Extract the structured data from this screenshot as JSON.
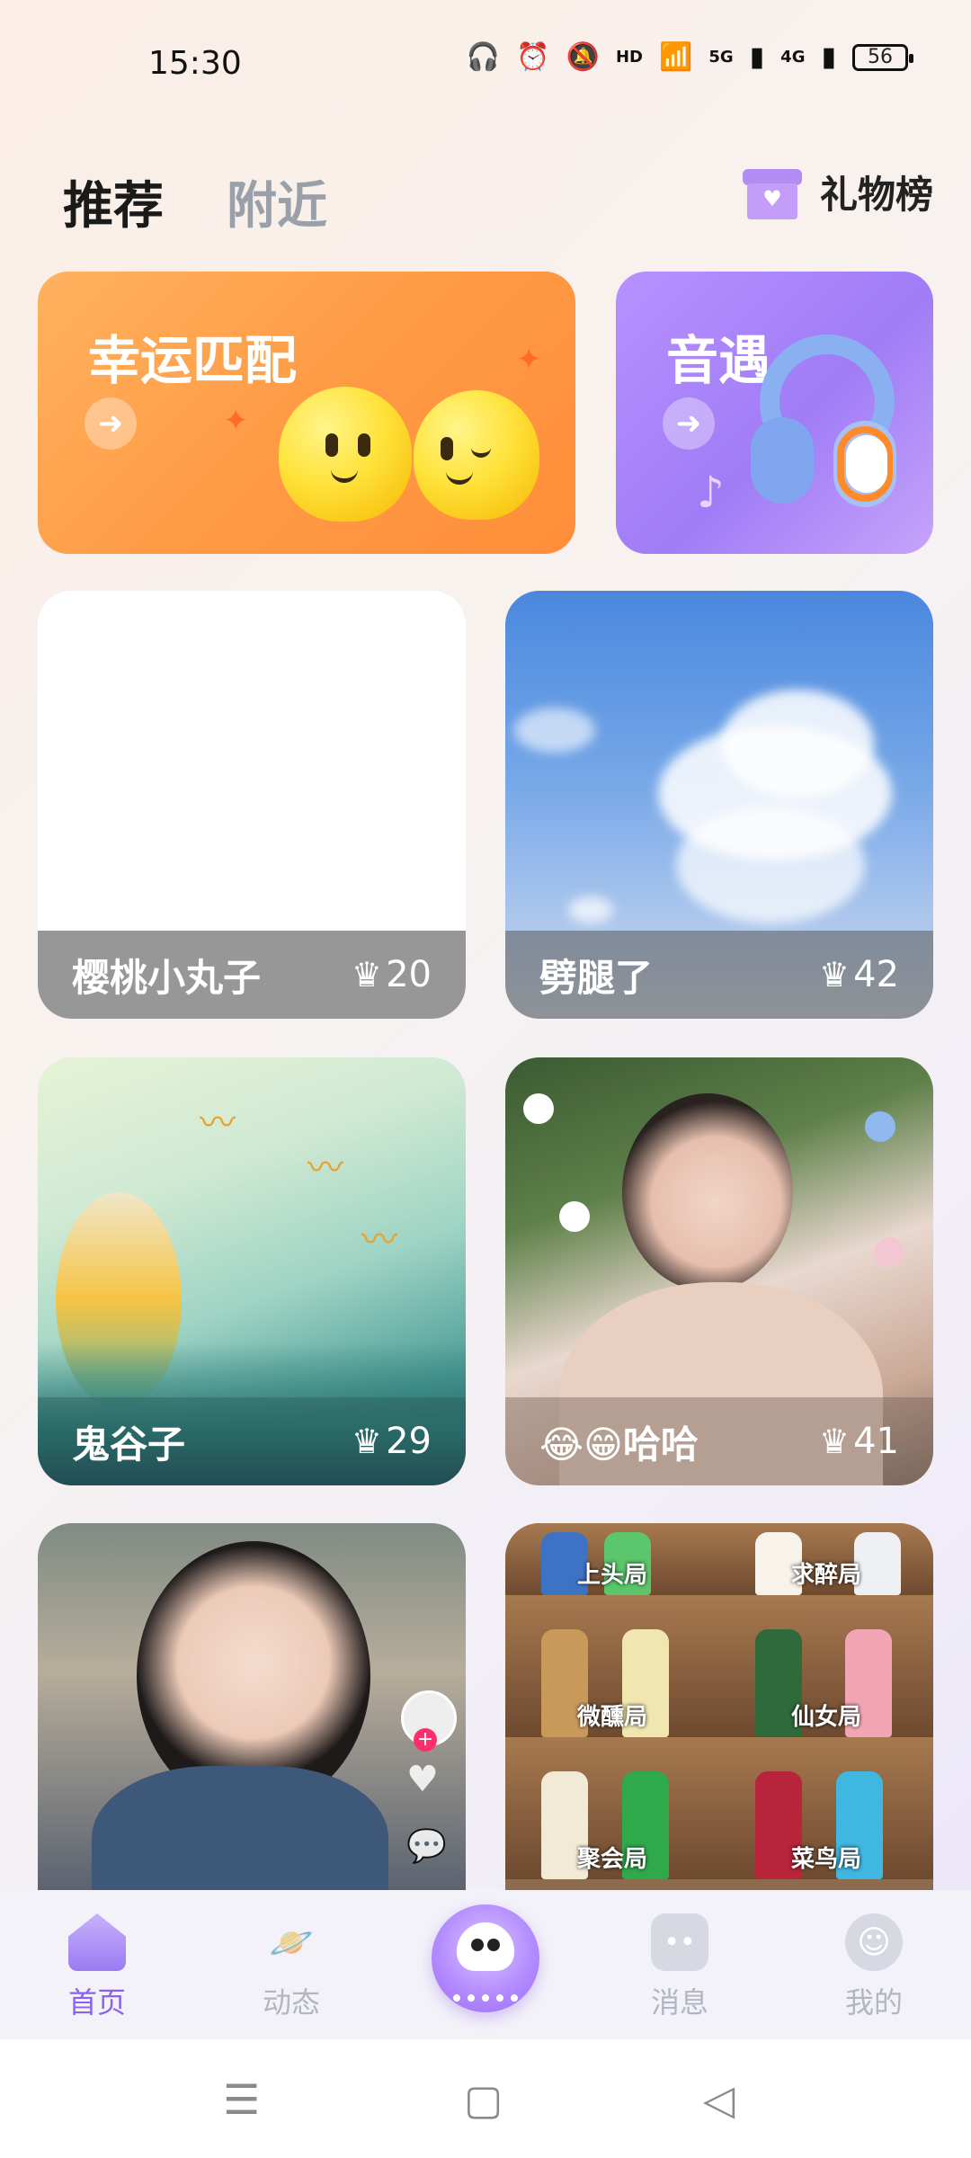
{
  "status_bar": {
    "time": "15:30",
    "net1": "5G",
    "net2": "4G",
    "battery": "56",
    "icons": [
      "headphones-icon",
      "alarm-icon",
      "mute-icon",
      "hd-icon",
      "wifi-icon",
      "signal-icon",
      "signal-icon",
      "battery-icon"
    ]
  },
  "header": {
    "tabs": [
      {
        "label": "推荐",
        "active": true
      },
      {
        "label": "附近",
        "active": false
      }
    ],
    "gift_label": "礼物榜"
  },
  "banners": {
    "lucky": {
      "title": "幸运匹配"
    },
    "music": {
      "title": "音遇"
    }
  },
  "rooms": [
    {
      "name": "樱桃小丸子",
      "count": "20"
    },
    {
      "name": "劈腿了",
      "count": "42"
    },
    {
      "name": "鬼谷子",
      "count": "29"
    },
    {
      "name": "😂😁哈哈",
      "count": "41"
    }
  ],
  "drinks": {
    "labels": [
      "上头局",
      "求醉局",
      "微醺局",
      "仙女局",
      "聚会局",
      "菜鸟局"
    ]
  },
  "bottom_nav": {
    "items": [
      {
        "label": "首页"
      },
      {
        "label": "动态"
      },
      {
        "label": "消息"
      },
      {
        "label": "我的"
      }
    ]
  },
  "colors": {
    "accent": "#8b62f0",
    "lucky_banner": "#ff9a45",
    "music_banner": "#a07cf6"
  }
}
